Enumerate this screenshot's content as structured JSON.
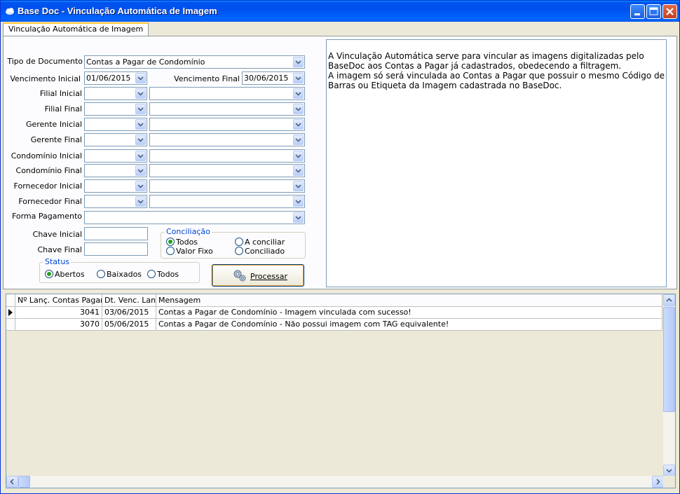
{
  "window": {
    "title": "Base Doc - Vinculação Automática de Imagem"
  },
  "tab": {
    "label": "Vinculação Automática de Imagem"
  },
  "form": {
    "tipo_documento_label": "Tipo de Documento",
    "tipo_documento_value": "Contas a Pagar de Condomínio",
    "venc_inicial_label": "Vencimento Inicial",
    "venc_inicial_value": "01/06/2015",
    "venc_final_label": "Vencimento Final",
    "venc_final_value": "30/06/2015",
    "filial_inicial_label": "Filial Inicial",
    "filial_final_label": "Filial Final",
    "gerente_inicial_label": "Gerente Inicial",
    "gerente_final_label": "Gerente Final",
    "condominio_inicial_label": "Condomínio Inicial",
    "condominio_final_label": "Condomínio Final",
    "fornecedor_inicial_label": "Fornecedor Inicial",
    "fornecedor_final_label": "Fornecedor Final",
    "forma_pagamento_label": "Forma Pagamento",
    "chave_inicial_label": "Chave Inicial",
    "chave_final_label": "Chave Final"
  },
  "conciliacao": {
    "title": "Conciliação",
    "options": [
      "Todos",
      "A conciliar",
      "Valor Fixo",
      "Conciliado"
    ],
    "selected": "Todos"
  },
  "status": {
    "title": "Status",
    "options": [
      "Abertos",
      "Baixados",
      "Todos"
    ],
    "selected": "Abertos"
  },
  "processar_button": {
    "label": "Processar",
    "underline": "P"
  },
  "info": {
    "line1": "A Vinculação Automática serve para vincular as imagens digitalizadas pelo BaseDoc aos Contas a Pagar já cadastrados, obedecendo a filtragem.",
    "line2": "A imagem só será vinculada ao Contas a Pagar que possuir o mesmo Código de Barras ou Etiqueta da Imagem cadastrada no BaseDoc."
  },
  "grid": {
    "columns": [
      "Nº Lanç. Contas Pagar",
      "Dt. Venc. Lanc",
      "Mensagem"
    ],
    "rows": [
      {
        "lanc": "3041",
        "data": "03/06/2015",
        "mensagem": "Contas a Pagar de Condomínio - Imagem vinculada com sucesso!"
      },
      {
        "lanc": "3070",
        "data": "05/06/2015",
        "mensagem": "Contas a Pagar de Condomínio - Não possui imagem com TAG equivalente!"
      }
    ]
  },
  "colors": {
    "title_bar": "#0054e3",
    "group_title": "#0046d5",
    "tab_accent": "#ffc73c"
  }
}
